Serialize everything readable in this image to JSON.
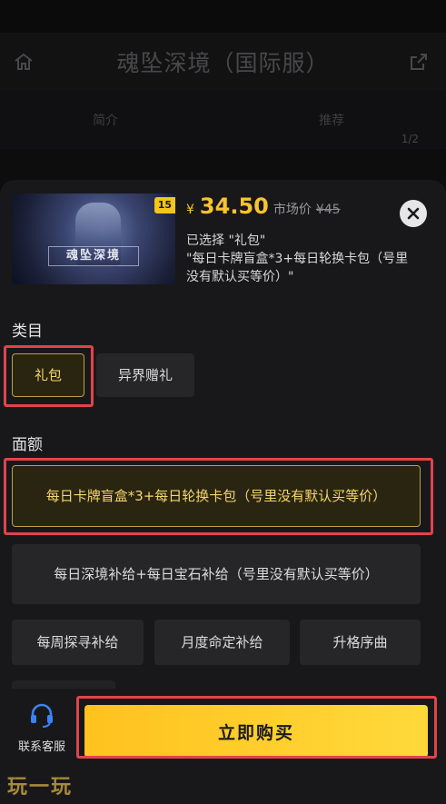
{
  "background": {
    "title": "魂坠深境（国际服）",
    "tabs": [
      "简介",
      "推荐"
    ],
    "page_indicator": "1/2"
  },
  "product": {
    "thumbnail_logo": "魂坠深境",
    "thumbnail_badge": "15",
    "currency": "¥",
    "price": "34.50",
    "market_label": "市场价",
    "market_price": "¥45",
    "selected_text": "已选择 \"礼包\"",
    "selected_detail": "\"每日卡牌盲盒*3+每日轮换卡包（号里没有默认买等价）\""
  },
  "category": {
    "title": "类目",
    "options": [
      "礼包",
      "异界赠礼"
    ],
    "selected": "礼包"
  },
  "denomination": {
    "title": "面额",
    "options": [
      "每日卡牌盲盒*3+每日轮换卡包（号里没有默认买等价）",
      "每日深境补给+每日宝石补给（号里没有默认买等价）",
      "每周探寻补给",
      "月度命定补给",
      "升格序曲"
    ],
    "selected": "每日卡牌盲盒*3+每日轮换卡包（号里没有默认买等价）"
  },
  "footer": {
    "service_label": "联系客服",
    "buy_label": "立即购买"
  },
  "watermark": "玩一玩",
  "colors": {
    "accent": "#f7c32e",
    "highlight": "#e0444a",
    "button": "#ffc21e"
  }
}
